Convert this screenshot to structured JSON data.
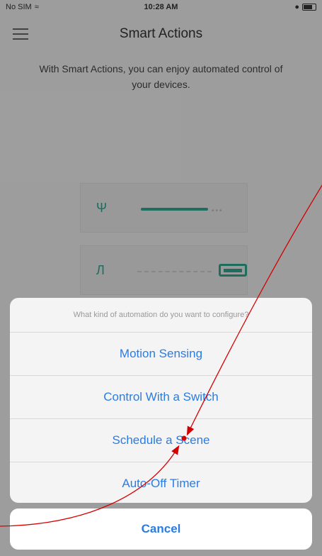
{
  "status_bar": {
    "carrier": "No SIM",
    "time": "10:28 AM"
  },
  "header": {
    "title": "Smart Actions"
  },
  "intro": {
    "text": "With Smart Actions, you can enjoy automated control of your devices."
  },
  "action_sheet": {
    "prompt": "What kind of automation do you want to configure?",
    "options": [
      {
        "label": "Motion Sensing"
      },
      {
        "label": "Control With a Switch"
      },
      {
        "label": "Schedule a Scene"
      },
      {
        "label": "Auto-Off Timer"
      }
    ],
    "cancel_label": "Cancel"
  },
  "colors": {
    "accent": "#2b7ce0",
    "brand": "#2eaa94",
    "annotation": "#d40000"
  },
  "icons": {
    "menu": "hamburger-icon",
    "sensor": "motion-sensor-icon",
    "switch": "switch-icon",
    "wifi": "wifi-icon",
    "battery": "battery-icon"
  }
}
